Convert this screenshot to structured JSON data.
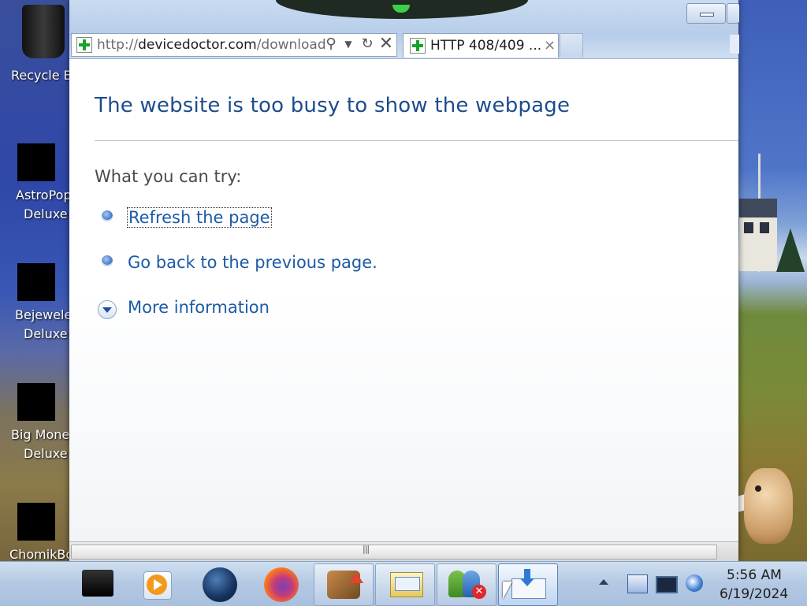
{
  "desktop": {
    "icons": [
      {
        "label_line1": "Recycle Bin",
        "label_line2": ""
      },
      {
        "label_line1": "AstroPop",
        "label_line2": "Deluxe"
      },
      {
        "label_line1": "Bejeweled",
        "label_line2": "Deluxe"
      },
      {
        "label_line1": "Big Money",
        "label_line2": "Deluxe"
      },
      {
        "label_line1": "ChomikBox",
        "label_line2": ""
      }
    ]
  },
  "browser": {
    "address": {
      "scheme": "http://",
      "host": "devicedoctor.com",
      "path": "/download"
    },
    "tab_title": "HTTP 408/409 ...",
    "page": {
      "title": "The website is too busy to show the webpage",
      "try_heading": "What you can try:",
      "links": {
        "refresh": "Refresh the page",
        "back": "Go back to the previous page.",
        "more": "More information"
      }
    }
  },
  "taskbar": {
    "clock_time": "5:56 AM",
    "clock_date": "6/19/2024"
  },
  "colors": {
    "link": "#1c5aa6",
    "title": "#1e4c8c"
  }
}
